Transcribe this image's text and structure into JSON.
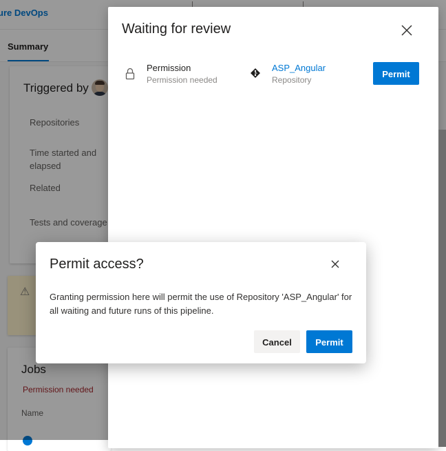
{
  "app": {
    "brand": "ure DevOps"
  },
  "tabs": {
    "summary": "Summary"
  },
  "summary_card": {
    "triggered_by": "Triggered by",
    "labels": {
      "repositories": "Repositories",
      "time": "Time started and elapsed",
      "related": "Related",
      "tests": "Tests and coverage"
    }
  },
  "jobs_card": {
    "title": "Jobs",
    "status": "Permission needed",
    "column_name": "Name"
  },
  "review_panel": {
    "title": "Waiting for review",
    "item": {
      "title": "Permission",
      "subtitle": "Permission needed",
      "resource_name": "ASP_Angular",
      "resource_type": "Repository",
      "action": "Permit"
    }
  },
  "dialog": {
    "title": "Permit access?",
    "body": "Granting permission here will permit the use of Repository 'ASP_Angular' for all waiting and future runs of this pipeline.",
    "cancel": "Cancel",
    "confirm": "Permit"
  },
  "colors": {
    "accent": "#0078d4",
    "error_text": "#a4262c",
    "overlay": "rgba(0,0,0,0.40)"
  },
  "icons": [
    "lock-icon",
    "git-repo-icon",
    "close-icon",
    "warning-icon",
    "avatar"
  ]
}
